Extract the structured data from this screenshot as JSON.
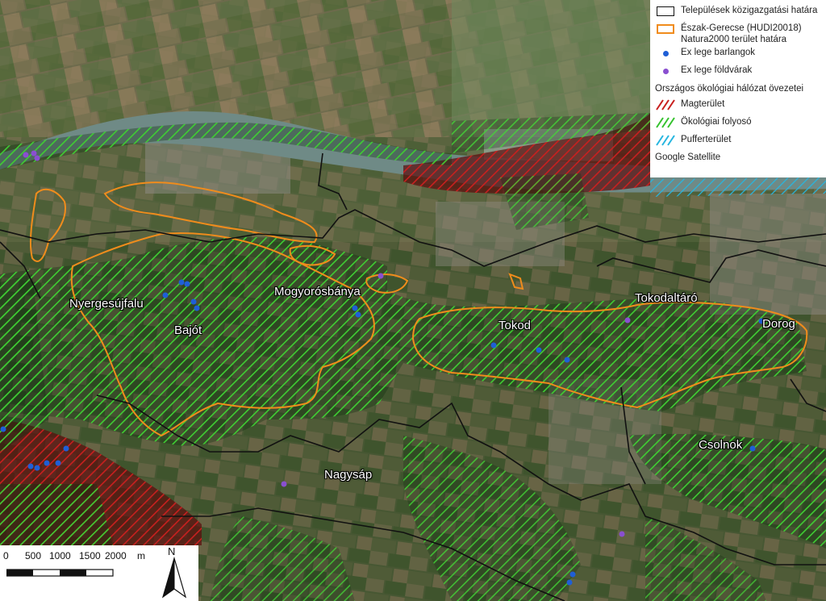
{
  "map": {
    "places": [
      {
        "name": "Nyergesújfalu"
      },
      {
        "name": "Bajót"
      },
      {
        "name": "Mogyorósbánya"
      },
      {
        "name": "Tokod"
      },
      {
        "name": "Tokodaltáró"
      },
      {
        "name": "Dorog"
      },
      {
        "name": "Csolnok"
      },
      {
        "name": "Nagysáp"
      }
    ]
  },
  "legend": {
    "items": [
      {
        "label": "Települések közigazgatási határa",
        "symbol": "black-outline-box",
        "color": "#111111"
      },
      {
        "label": "Észak-Gerecse (HUDI20018) Natura2000 terület határa",
        "symbol": "orange-outline-box",
        "color": "#f08c1c"
      },
      {
        "label": "Ex lege barlangok",
        "symbol": "blue-dot",
        "color": "#1f5fd6"
      },
      {
        "label": "Ex lege földvárak",
        "symbol": "purple-dot",
        "color": "#8a4fd0"
      }
    ],
    "heading": "Országos ökológiai hálózat övezetei",
    "zones": [
      {
        "label": "Magterület",
        "symbol": "red-hatch",
        "color": "#c8201f"
      },
      {
        "label": "Ökológiai folyosó",
        "symbol": "green-hatch",
        "color": "#35c22e"
      },
      {
        "label": "Pufferterület",
        "symbol": "cyan-hatch",
        "color": "#27b6e0"
      }
    ],
    "basemap": "Google Satellite"
  },
  "scalebar": {
    "ticks": [
      "0",
      "500",
      "1000",
      "1500",
      "2000"
    ],
    "unit": "m",
    "north": "N"
  }
}
